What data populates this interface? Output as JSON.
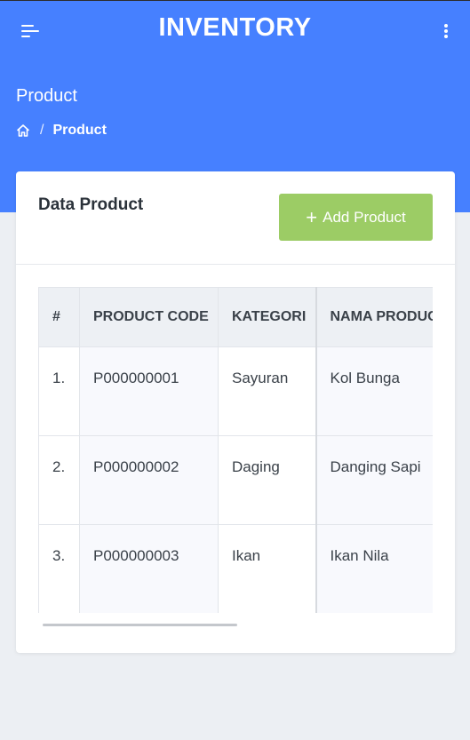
{
  "header": {
    "title": "INVENTORY",
    "menu_icon": "menu-icon",
    "more_icon": "more-vertical-icon"
  },
  "page": {
    "title": "Product",
    "breadcrumb": {
      "home_icon": "home-icon",
      "separator": "/",
      "current": "Product"
    }
  },
  "card": {
    "title": "Data Product",
    "add_button": {
      "icon": "+",
      "label": "Add Product"
    }
  },
  "table": {
    "columns": [
      "#",
      "PRODUCT CODE",
      "KATEGORI",
      "NAMA PRODUCT"
    ],
    "rows": [
      {
        "num": "1.",
        "code": "P000000001",
        "kategori": "Sayuran",
        "nama": "Kol Bunga"
      },
      {
        "num": "2.",
        "code": "P000000002",
        "kategori": "Daging",
        "nama": "Danging Sapi"
      },
      {
        "num": "3.",
        "code": "P000000003",
        "kategori": "Ikan",
        "nama": "Ikan Nila"
      }
    ]
  },
  "colors": {
    "primary": "#4680ff",
    "success": "#9ccc65",
    "background": "#eceff3"
  }
}
